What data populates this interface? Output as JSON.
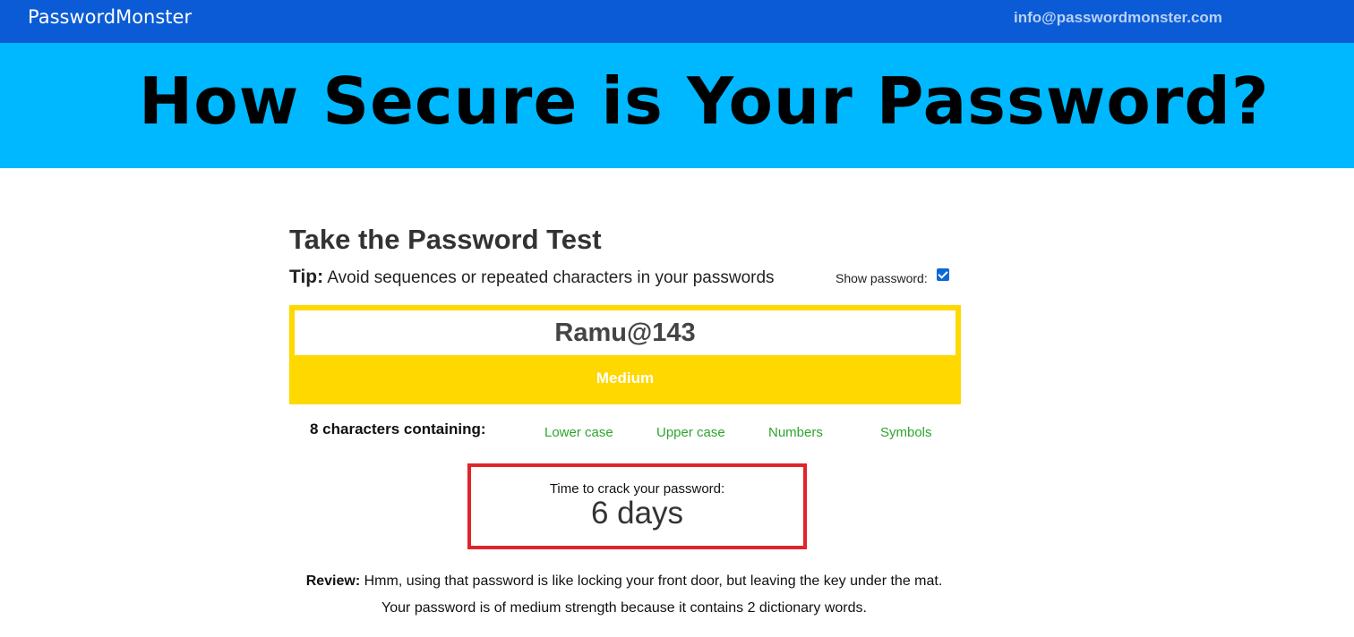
{
  "header": {
    "brand": "PasswordMonster",
    "email": "info@passwordmonster.com",
    "bar_color": "#0b5bd6"
  },
  "banner": {
    "headline": "How Secure is Your Password?",
    "color": "#00b8ff"
  },
  "test": {
    "title": "Take the Password Test",
    "tip_label": "Tip:",
    "tip_text": " Avoid sequences or repeated characters in your passwords",
    "show_password_label": "Show password:",
    "show_password_checked": true,
    "password_value": "Ramu@143",
    "strength_label": "Medium",
    "strength_color": "#ffd800",
    "characters_summary": "8 characters containing:",
    "features": [
      "Lower case",
      "Upper case",
      "Numbers",
      "Symbols"
    ],
    "feature_color": "#2ea52e",
    "crack_label": "Time to crack your password:",
    "crack_value": "6 days",
    "review_label": "Review:",
    "review_text": " Hmm, using that password is like locking your front door, but leaving the key under the mat.",
    "review_detail": "Your password is of medium strength because it contains 2 dictionary words."
  }
}
